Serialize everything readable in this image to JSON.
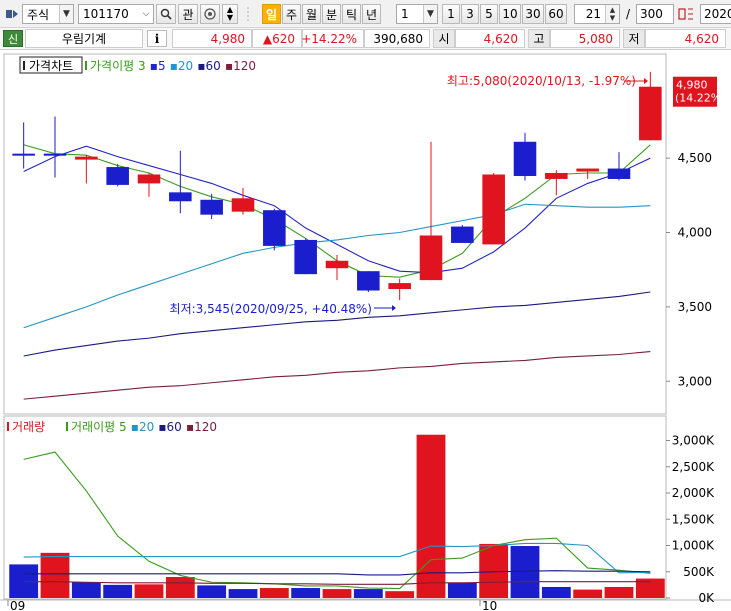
{
  "toolbar": {
    "market_type": "주식",
    "stock_code": "101170",
    "search_label": "관",
    "period_buttons": [
      {
        "label": "일",
        "active": true
      },
      {
        "label": "주",
        "active": false
      },
      {
        "label": "월",
        "active": false
      },
      {
        "label": "분",
        "active": false
      },
      {
        "label": "틱",
        "active": false
      },
      {
        "label": "년",
        "active": false
      }
    ],
    "period_value": "1",
    "interval_buttons": [
      "1",
      "3",
      "5",
      "10",
      "30",
      "60"
    ],
    "display_count": "21",
    "total_count": "300",
    "date_field": "2020/"
  },
  "quote": {
    "badge": "신",
    "stock_name": "우림기계",
    "info_label": "i",
    "current_price": "4,980",
    "change": "▲620",
    "change_rate": "+14.22%",
    "volume": "390,680",
    "open_label": "시",
    "open": "4,620",
    "high_label": "고",
    "high": "5,080",
    "low_label": "저",
    "low": "4,620"
  },
  "price_panel": {
    "title": "가격차트",
    "legend_prefix": "가격이평",
    "legend_items": [
      {
        "label": "3",
        "color": "#3a9c1c"
      },
      {
        "label": "5",
        "color": "#2424c8"
      },
      {
        "label": "20",
        "color": "#2296c6"
      },
      {
        "label": "60",
        "color": "#1a1a80"
      },
      {
        "label": "120",
        "color": "#7a1e3c"
      }
    ],
    "high_annotation": "최고:5,080(2020/10/13, -1.97%)",
    "low_annotation": "최저:3,545(2020/09/25, +40.48%)",
    "last_price_label": "4,980",
    "last_price_pct": "(14.22%)"
  },
  "volume_panel": {
    "title": "거래량",
    "legend_prefix": "거래이평",
    "legend_items": [
      {
        "label": "5",
        "color": "#3a9c1c"
      },
      {
        "label": "20",
        "color": "#2296c6"
      },
      {
        "label": "60",
        "color": "#1a1a80"
      },
      {
        "label": "120",
        "color": "#7a1e3c"
      }
    ]
  },
  "x_axis_labels": [
    {
      "label": "09",
      "candle_index": 0
    },
    {
      "label": "10",
      "candle_index": 15
    }
  ],
  "colors": {
    "up": "#e0141e",
    "down": "#1a1ecc",
    "flat_tick": "#1a1ecc"
  },
  "chart_data": [
    {
      "type": "candlestick",
      "title": "가격차트",
      "y_ticks": [
        3000,
        3500,
        4000,
        4500
      ],
      "y_tick_labels": [
        "3,000",
        "3,500",
        "4,000",
        "4,500"
      ],
      "ylim": [
        2780,
        5200
      ],
      "candles": [
        {
          "o": 4530,
          "h": 4740,
          "l": 4430,
          "c": 4530,
          "dir": "flat"
        },
        {
          "o": 4530,
          "h": 4780,
          "l": 4370,
          "c": 4530,
          "dir": "flat"
        },
        {
          "o": 4510,
          "h": 4520,
          "l": 4330,
          "c": 4490,
          "dir": "up"
        },
        {
          "o": 4440,
          "h": 4460,
          "l": 4310,
          "c": 4320,
          "dir": "down"
        },
        {
          "o": 4330,
          "h": 4400,
          "l": 4240,
          "c": 4390,
          "dir": "up"
        },
        {
          "o": 4270,
          "h": 4550,
          "l": 4130,
          "c": 4210,
          "dir": "down"
        },
        {
          "o": 4220,
          "h": 4260,
          "l": 4090,
          "c": 4120,
          "dir": "down"
        },
        {
          "o": 4140,
          "h": 4300,
          "l": 4120,
          "c": 4230,
          "dir": "up"
        },
        {
          "o": 4150,
          "h": 4160,
          "l": 3880,
          "c": 3910,
          "dir": "down"
        },
        {
          "o": 3950,
          "h": 3960,
          "l": 3720,
          "c": 3720,
          "dir": "down"
        },
        {
          "o": 3760,
          "h": 3850,
          "l": 3680,
          "c": 3810,
          "dir": "up"
        },
        {
          "o": 3740,
          "h": 3740,
          "l": 3600,
          "c": 3610,
          "dir": "down"
        },
        {
          "o": 3620,
          "h": 3690,
          "l": 3545,
          "c": 3660,
          "dir": "up"
        },
        {
          "o": 3680,
          "h": 4610,
          "l": 3680,
          "c": 3980,
          "dir": "up"
        },
        {
          "o": 4040,
          "h": 4050,
          "l": 3930,
          "c": 3930,
          "dir": "down"
        },
        {
          "o": 3920,
          "h": 4400,
          "l": 3920,
          "c": 4390,
          "dir": "up"
        },
        {
          "o": 4610,
          "h": 4670,
          "l": 4350,
          "c": 4380,
          "dir": "down"
        },
        {
          "o": 4360,
          "h": 4420,
          "l": 4250,
          "c": 4400,
          "dir": "up"
        },
        {
          "o": 4410,
          "h": 4430,
          "l": 4360,
          "c": 4430,
          "dir": "up"
        },
        {
          "o": 4430,
          "h": 4540,
          "l": 4350,
          "c": 4360,
          "dir": "down"
        },
        {
          "o": 4620,
          "h": 5080,
          "l": 4620,
          "c": 4980,
          "dir": "up"
        }
      ],
      "series": [
        {
          "name": "3",
          "values": [
            4590,
            4530,
            4520,
            4450,
            4400,
            4310,
            4240,
            4190,
            4090,
            3960,
            3810,
            3710,
            3700,
            3750,
            3860,
            4100,
            4230,
            4390,
            4400,
            4400,
            4590
          ]
        },
        {
          "name": "5",
          "values": [
            4410,
            4510,
            4580,
            4510,
            4450,
            4390,
            4330,
            4250,
            4180,
            4030,
            3920,
            3810,
            3740,
            3730,
            3760,
            3870,
            4030,
            4230,
            4330,
            4400,
            4500
          ]
        },
        {
          "name": "20",
          "values": [
            3360,
            3430,
            3500,
            3580,
            3650,
            3720,
            3790,
            3860,
            3900,
            3930,
            3950,
            3980,
            4000,
            4040,
            4080,
            4120,
            4190,
            4180,
            4170,
            4170,
            4180
          ]
        },
        {
          "name": "60",
          "values": [
            3170,
            3210,
            3240,
            3270,
            3290,
            3320,
            3340,
            3360,
            3380,
            3400,
            3410,
            3430,
            3440,
            3460,
            3480,
            3500,
            3510,
            3530,
            3550,
            3570,
            3600
          ]
        },
        {
          "name": "120",
          "values": [
            2880,
            2900,
            2920,
            2940,
            2960,
            2970,
            2990,
            3010,
            3030,
            3040,
            3060,
            3070,
            3090,
            3100,
            3120,
            3130,
            3140,
            3160,
            3170,
            3180,
            3200
          ]
        }
      ]
    },
    {
      "type": "bar",
      "title": "거래량",
      "y_ticks": [
        0,
        500000,
        1000000,
        1500000,
        2000000,
        2500000,
        3000000
      ],
      "y_tick_labels": [
        "0K",
        "500K",
        "1,000K",
        "1,500K",
        "2,000K",
        "2,500K",
        "3,000K"
      ],
      "ylim": [
        0,
        3200000
      ],
      "values": [
        640000,
        860000,
        300000,
        250000,
        260000,
        400000,
        240000,
        170000,
        190000,
        190000,
        170000,
        170000,
        130000,
        3110000,
        290000,
        1030000,
        990000,
        210000,
        160000,
        210000,
        370000
      ],
      "dirs": [
        "down",
        "up",
        "down",
        "down",
        "up",
        "up",
        "down",
        "down",
        "up",
        "down",
        "up",
        "down",
        "up",
        "up",
        "down",
        "up",
        "down",
        "down",
        "up",
        "up",
        "up"
      ],
      "series": [
        {
          "name": "5",
          "values": [
            2640,
            2780,
            2040,
            1180,
            700,
            430,
            300,
            290,
            270,
            230,
            230,
            190,
            180,
            730,
            760,
            1000,
            1110,
            1140,
            570,
            530,
            470
          ]
        },
        {
          "name": "20",
          "values": [
            780,
            790,
            790,
            790,
            790,
            790,
            790,
            790,
            790,
            790,
            790,
            790,
            790,
            990,
            980,
            1000,
            1040,
            1040,
            1000,
            480,
            490
          ]
        },
        {
          "name": "60",
          "values": [
            460,
            460,
            460,
            460,
            460,
            460,
            460,
            460,
            460,
            460,
            460,
            440,
            440,
            480,
            480,
            500,
            510,
            520,
            510,
            510,
            500
          ]
        },
        {
          "name": "120",
          "values": [
            310,
            310,
            300,
            290,
            290,
            290,
            280,
            280,
            270,
            270,
            260,
            260,
            260,
            290,
            290,
            300,
            310,
            310,
            310,
            310,
            310
          ]
        }
      ]
    }
  ]
}
